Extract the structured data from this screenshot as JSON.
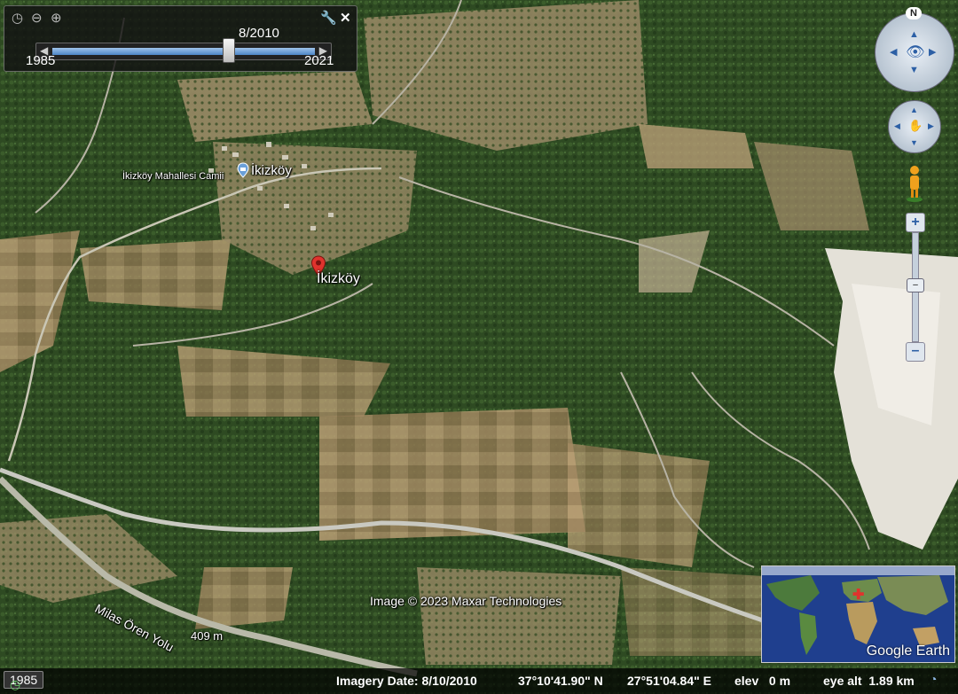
{
  "map": {
    "village_label": "İkizköy",
    "mosque_label": "İkizköy Mahallesi Camii",
    "pin_label": "İkizköy",
    "road_label": "Milas Ören Yolu",
    "scale_label": "409 m",
    "copyright": "Image © 2023 Maxar Technologies"
  },
  "timeslider": {
    "current": "8/2010",
    "start": "1985",
    "end": "2021",
    "position_fraction": 0.69
  },
  "compass": {
    "north": "N"
  },
  "status": {
    "year_button": "1985",
    "imagery_date": "Imagery Date: 8/10/2010",
    "lat": "37°10'41.90\" N",
    "lon": "27°51'04.84\" E",
    "elev": "elev   0 m",
    "eye_alt": "eye alt  1.89 km"
  },
  "minimap": {
    "logo": "Google Earth"
  },
  "colors": {
    "accent": "#4d86c8",
    "pin": "#e0332d"
  }
}
